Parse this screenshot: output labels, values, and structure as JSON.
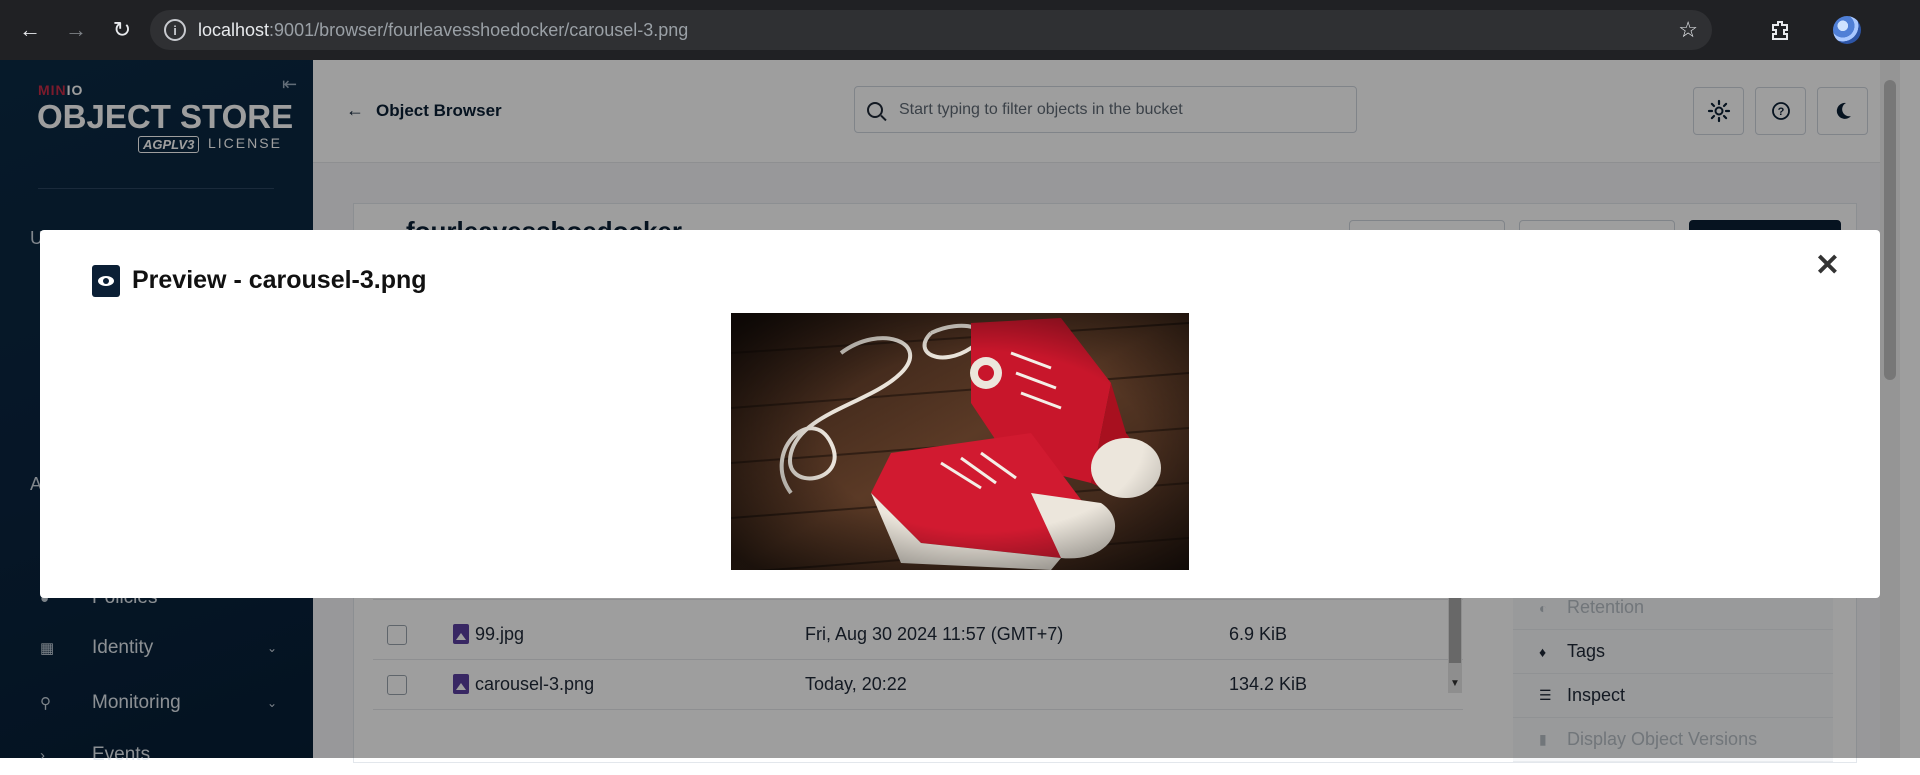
{
  "browser": {
    "url_host": "localhost",
    "url_rest": ":9001/browser/fourleavesshoedocker/carousel-3.png"
  },
  "sidebar": {
    "logo_mini_a": "MIN",
    "logo_mini_b": "IO",
    "logo_main": "OBJECT STORE",
    "logo_badge": "AGPLV3",
    "logo_license": "LICENSE",
    "stub_u": "U",
    "stub_a": "A",
    "items": [
      {
        "label": "Policies",
        "icon": "policies-icon"
      },
      {
        "label": "Identity",
        "icon": "identity-icon"
      },
      {
        "label": "Monitoring",
        "icon": "monitoring-icon"
      },
      {
        "label": "Events",
        "icon": "events-icon"
      }
    ]
  },
  "header": {
    "back_label": "Object Browser",
    "search_placeholder": "Start typing to filter objects in the bucket"
  },
  "bucket": {
    "name": "fourleavesshoedocker"
  },
  "objects": [
    {
      "name": "99.jpg",
      "date": "Fri, Aug 30 2024 11:57 (GMT+7)",
      "size": "6.9 KiB"
    },
    {
      "name": "carousel-3.png",
      "date": "Today, 20:22",
      "size": "134.2 KiB"
    }
  ],
  "actions": [
    {
      "label": "Retention",
      "icon": "retention-icon",
      "disabled": true
    },
    {
      "label": "Tags",
      "icon": "tag-icon",
      "disabled": false
    },
    {
      "label": "Inspect",
      "icon": "inspect-icon",
      "disabled": false
    },
    {
      "label": "Display Object Versions",
      "icon": "versions-icon",
      "disabled": true
    }
  ],
  "modal": {
    "title": "Preview - carousel-3.png"
  },
  "colors": {
    "sidebar_bg": "#0a2540",
    "brand_red": "#c72c48",
    "primary_dark": "#0b1f35"
  }
}
